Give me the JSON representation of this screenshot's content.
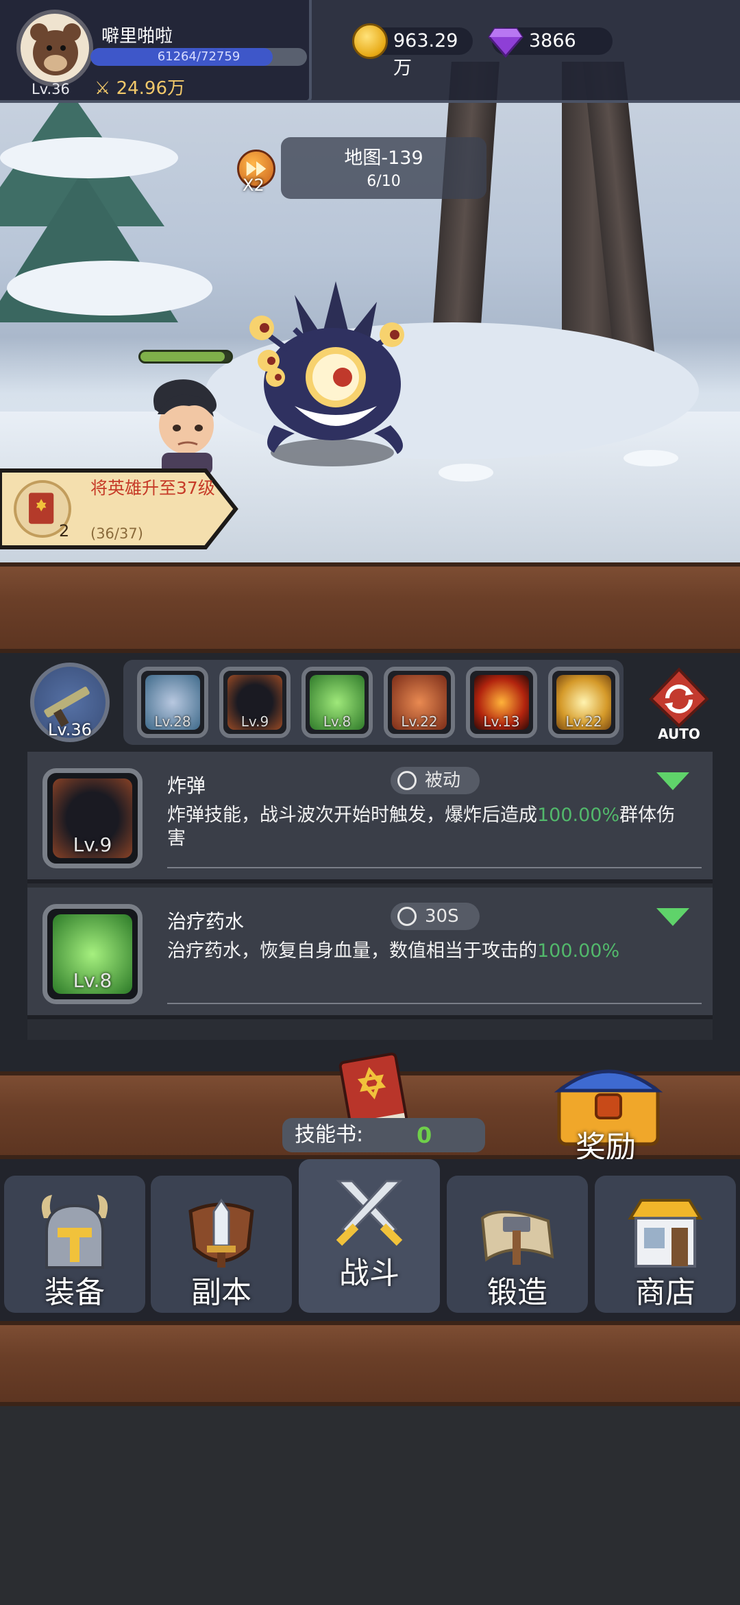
{
  "player": {
    "name": "噼里啪啦",
    "level": "Lv.36",
    "exp_text": "61264/72759",
    "exp_fraction": 0.842,
    "power": "24.96万",
    "avatar": "bear-avatar-icon"
  },
  "currency": {
    "gold": "963.29万",
    "gems": "3866"
  },
  "battle": {
    "speed_label": "X2",
    "map_name": "地图-139",
    "wave": "6/10",
    "hero_hp_fraction": 0.93
  },
  "quest": {
    "title": "将英雄升至37级",
    "item_count": "2",
    "progress": "(36/37)"
  },
  "weapon": {
    "level": "Lv.36",
    "icon": "rifle-icon"
  },
  "skill_slots": [
    {
      "level": "Lv.28",
      "icon": "target-icon"
    },
    {
      "level": "Lv.9",
      "icon": "bomb-icon"
    },
    {
      "level": "Lv.8",
      "icon": "heal-potion-icon"
    },
    {
      "level": "Lv.22",
      "icon": "fire-creature-icon"
    },
    {
      "level": "Lv.13",
      "icon": "sun-blast-icon"
    },
    {
      "level": "Lv.22",
      "icon": "lightning-icon"
    }
  ],
  "auto_label": "AUTO",
  "skills": [
    {
      "name": "炸弹",
      "level": "Lv.9",
      "type": "被动",
      "desc_before": "炸弹技能，战斗波次开始时触发，爆炸后造成",
      "desc_highlight": "100.00%",
      "desc_after": "群体伤害"
    },
    {
      "name": "治疗药水",
      "level": "Lv.8",
      "type": "30S",
      "desc_before": "治疗药水，恢复自身血量，数值相当于攻击的",
      "desc_highlight": "100.00%",
      "desc_after": ""
    }
  ],
  "skill_book": {
    "label": "技能书:",
    "value": "0"
  },
  "reward_label": "奖励",
  "nav": [
    {
      "label": "装备",
      "icon": "helmet-icon"
    },
    {
      "label": "副本",
      "icon": "sword-shield-icon"
    },
    {
      "label": "战斗",
      "icon": "crossed-swords-icon"
    },
    {
      "label": "锻造",
      "icon": "hammer-scroll-icon"
    },
    {
      "label": "商店",
      "icon": "shop-icon"
    }
  ],
  "colors": {
    "accent_green": "#52b86b",
    "exp_blue": "#3e57c9",
    "gold": "#f1c86a"
  }
}
